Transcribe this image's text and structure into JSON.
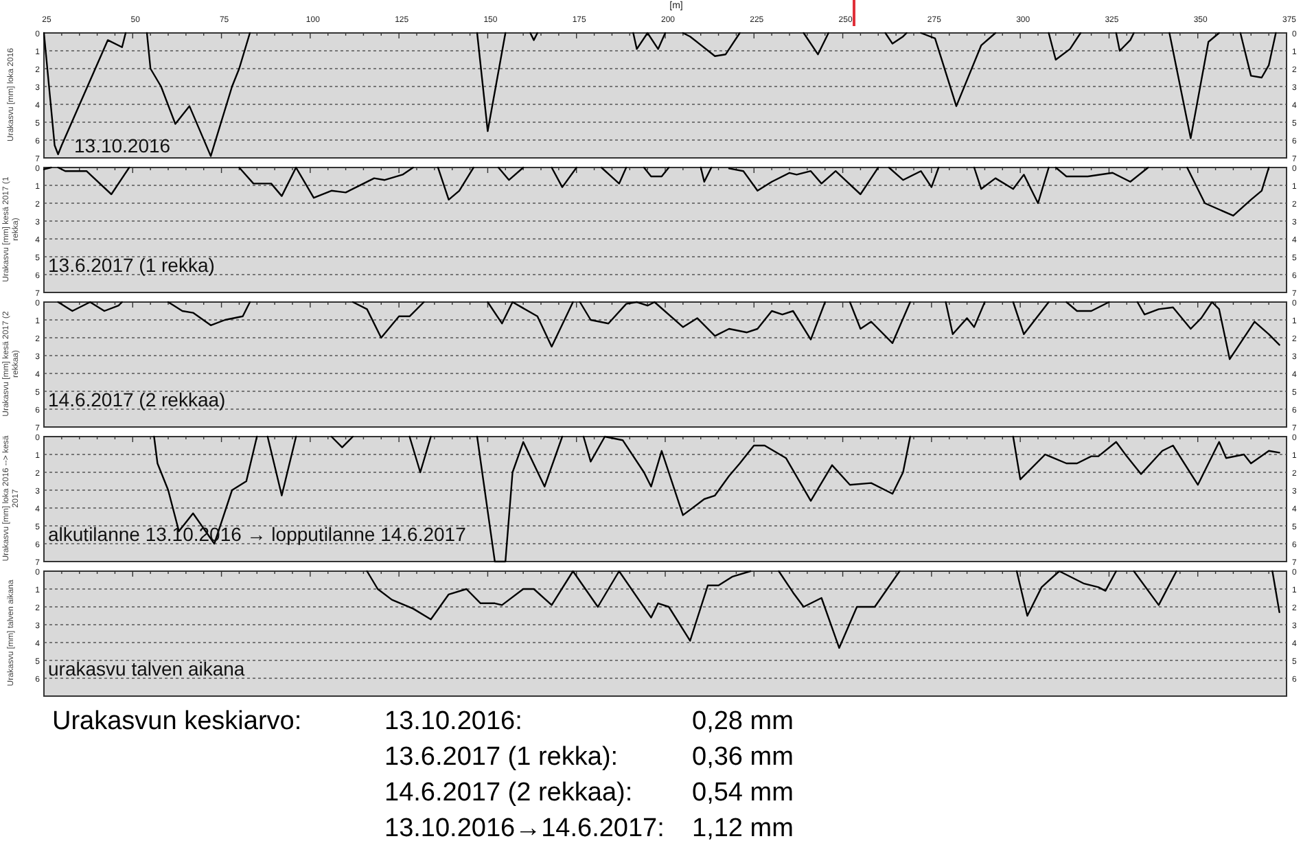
{
  "charts": [
    {
      "right_axis_labels": [
        "0",
        "1",
        "2",
        "3",
        "4",
        "5",
        "6",
        "7"
      ],
      "chart_data": {
        "type": "line",
        "title": "13.10.2016",
        "xlabel": "[m]",
        "ylabel": "Urakasvu [mm] loka 2016",
        "xlim": [
          25,
          375
        ],
        "ylim": [
          7,
          0
        ],
        "grid": true,
        "xticks": [
          25,
          50,
          75,
          100,
          125,
          150,
          175,
          200,
          225,
          250,
          275,
          300,
          325,
          350,
          375
        ],
        "yticks": [
          0,
          1,
          2,
          3,
          4,
          5,
          6,
          7
        ],
        "x": [
          25,
          28,
          29,
          30,
          43,
          47,
          48,
          51,
          54,
          55,
          58,
          62,
          66,
          72,
          78,
          80,
          83,
          115,
          147,
          150,
          155,
          158,
          162,
          163,
          164,
          178,
          191,
          192,
          195,
          198,
          200,
          202,
          205,
          207,
          214,
          217,
          221,
          230,
          239,
          243,
          246,
          254,
          262,
          264,
          267,
          268,
          270,
          272,
          276,
          282,
          289,
          293,
          300,
          308,
          310,
          314,
          317,
          322,
          327,
          328,
          331,
          332,
          337,
          342,
          348,
          353,
          356,
          359,
          362,
          365,
          368,
          370,
          372
        ],
        "series": [
          {
            "color": "#000000",
            "values": [
              0,
              6.3,
              6.8,
              6.3,
              0.4,
              0.8,
              0,
              null,
              0,
              2,
              3,
              5.1,
              4.1,
              6.9,
              3,
              2,
              0,
              null,
              0,
              5.5,
              0,
              null,
              0,
              0.4,
              0,
              null,
              0,
              0.9,
              0,
              0.9,
              0,
              null,
              0,
              0.2,
              1.3,
              1.2,
              0,
              null,
              0,
              1.2,
              0,
              null,
              0,
              0.6,
              0.2,
              0,
              null,
              0,
              0.3,
              4.1,
              0.7,
              0,
              null,
              0,
              1.5,
              0.9,
              0,
              null,
              0,
              1,
              0.4,
              0,
              null,
              0,
              5.9,
              0.5,
              0,
              null,
              0,
              2.4,
              2.5,
              1.8,
              0
            ]
          }
        ]
      }
    },
    {
      "right_axis_labels": [
        "0",
        "1",
        "2",
        "3",
        "4",
        "5",
        "6",
        "7"
      ],
      "chart_data": {
        "type": "line",
        "title": "13.6.2017 (1 rekka)",
        "ylabel": "Urakasvu [mm] kesä 2017 (1 rekka)",
        "xlim": [
          25,
          375
        ],
        "ylim": [
          7,
          0
        ],
        "grid": true,
        "yticks": [
          0,
          1,
          2,
          3,
          4,
          5,
          6,
          7
        ],
        "x": [
          25,
          27,
          28,
          29,
          31,
          37,
          44,
          49,
          64,
          80,
          84,
          89,
          92,
          96,
          101,
          106,
          110,
          118,
          121,
          126,
          129,
          132,
          136,
          139,
          142,
          146,
          150,
          153,
          156,
          160,
          164,
          168,
          171,
          175,
          178,
          182,
          187,
          189,
          191,
          194,
          196,
          199,
          201,
          206,
          210,
          211,
          213,
          216,
          218,
          222,
          226,
          230,
          235,
          237,
          241,
          244,
          248,
          255,
          260,
          262,
          263,
          267,
          272,
          275,
          277,
          282,
          287,
          289,
          293,
          298,
          301,
          305,
          308,
          309,
          310,
          313,
          319,
          326,
          331,
          336,
          341,
          347,
          352,
          360,
          365,
          368,
          370
        ],
        "series": [
          {
            "color": "#000000",
            "values": [
              0.1,
              0,
              null,
              0,
              0.2,
              0.2,
              1.5,
              0,
              null,
              0,
              0.9,
              0.9,
              1.6,
              0,
              1.7,
              1.3,
              1.4,
              0.6,
              0.7,
              0.4,
              0,
              null,
              0,
              1.8,
              1.3,
              0,
              null,
              0,
              0.7,
              0,
              null,
              0,
              1.1,
              0,
              null,
              0,
              0.9,
              0,
              null,
              0,
              0.5,
              0.5,
              0,
              null,
              0,
              0.8,
              0,
              null,
              0.05,
              0.2,
              1.3,
              0.8,
              0.3,
              0.4,
              0.2,
              0.9,
              0.2,
              1.5,
              0,
              null,
              0,
              0.7,
              0.2,
              1.1,
              0,
              null,
              0,
              1.2,
              0.6,
              1.2,
              0.4,
              2,
              0,
              null,
              0,
              0.5,
              0.5,
              0.3,
              0.8,
              0,
              null,
              0,
              2,
              2.7,
              1.8,
              1.3,
              0
            ]
          }
        ]
      }
    },
    {
      "right_axis_labels": [
        "0",
        "1",
        "2",
        "3",
        "4",
        "5",
        "6",
        "7"
      ],
      "chart_data": {
        "type": "line",
        "title": "14.6.2017 (2 rekkaa)",
        "ylabel": "Urakasvu [mm] kesä 2017 (2 rekkaa)",
        "xlim": [
          25,
          375
        ],
        "ylim": [
          7,
          0
        ],
        "grid": true,
        "yticks": [
          0,
          1,
          2,
          3,
          4,
          5,
          6,
          7
        ],
        "x": [
          29,
          33,
          38,
          42,
          46,
          47,
          54,
          60,
          64,
          67,
          72,
          76,
          81,
          83,
          98,
          112,
          116,
          120,
          125,
          128,
          132,
          141,
          150,
          154,
          157,
          164,
          168,
          174,
          175,
          176,
          179,
          184,
          189,
          192,
          195,
          197,
          205,
          209,
          214,
          218,
          223,
          226,
          230,
          233,
          236,
          241,
          245,
          248,
          252,
          255,
          258,
          264,
          269,
          274,
          279,
          281,
          285,
          287,
          290,
          294,
          298,
          301,
          308,
          310,
          313,
          316,
          320,
          325,
          329,
          333,
          335,
          339,
          343,
          348,
          351,
          354,
          356,
          359,
          366,
          370,
          373
        ],
        "series": [
          {
            "color": "#000000",
            "values": [
              0,
              0.5,
              0,
              0.5,
              0.2,
              0,
              null,
              0,
              0.5,
              0.6,
              1.3,
              1,
              0.8,
              0,
              null,
              0,
              0.4,
              2,
              0.8,
              0.8,
              0,
              null,
              0,
              1.2,
              0,
              0.8,
              2.5,
              0,
              null,
              0,
              1,
              1.2,
              0.1,
              0,
              0.2,
              0,
              1.4,
              0.9,
              1.9,
              1.5,
              1.7,
              1.5,
              0.5,
              0.7,
              0.5,
              2.1,
              0,
              null,
              0,
              1.5,
              1.1,
              2.3,
              0,
              null,
              0,
              1.8,
              0.9,
              1.4,
              0,
              null,
              0,
              1.8,
              0,
              null,
              0,
              0.5,
              0.5,
              0,
              null,
              0,
              0.7,
              0.4,
              0.3,
              1.5,
              0.9,
              0,
              0.4,
              3.2,
              1.1,
              1.8,
              2.4
            ]
          }
        ]
      }
    },
    {
      "right_axis_labels": [
        "0",
        "1",
        "2",
        "3",
        "4",
        "5",
        "6",
        "7"
      ],
      "chart_data": {
        "type": "line",
        "title": "alkutilanne 13.10.2016 → lopputilanne 14.6.2017",
        "ylabel": "Urakasvu [mm] loka 2016 --> kesä 2017",
        "xlim": [
          25,
          375
        ],
        "ylim": [
          7,
          0
        ],
        "grid": true,
        "yticks": [
          0,
          1,
          2,
          3,
          4,
          5,
          6,
          7
        ],
        "x": [
          56,
          57,
          60,
          63,
          67,
          73,
          78,
          82,
          85,
          87,
          88,
          92,
          96,
          101,
          106,
          109,
          112,
          120,
          128,
          131,
          134,
          140,
          147,
          152,
          155,
          157,
          160,
          166,
          171,
          174,
          177,
          179,
          183,
          188,
          194,
          196,
          199,
          205,
          211,
          214,
          218,
          221,
          225,
          228,
          234,
          241,
          247,
          252,
          258,
          262,
          264,
          267,
          269,
          284,
          298,
          300,
          307,
          313,
          316,
          320,
          322,
          327,
          330,
          334,
          340,
          343,
          350,
          356,
          358,
          363,
          365,
          370,
          373
        ],
        "series": [
          {
            "color": "#000000",
            "values": [
              0,
              1.5,
              3,
              5.3,
              4.3,
              6,
              3,
              2.5,
              0,
              null,
              0,
              3.3,
              0,
              null,
              0,
              0.6,
              0,
              null,
              0,
              2,
              0,
              null,
              0,
              7,
              7,
              2,
              0.3,
              2.8,
              0,
              null,
              0,
              1.4,
              0,
              0.2,
              2,
              2.8,
              0.8,
              4.4,
              3.5,
              3.3,
              2.2,
              1.5,
              0.5,
              0.5,
              1.2,
              3.6,
              1.6,
              2.7,
              2.6,
              3,
              3.2,
              2,
              0,
              null,
              0,
              2.4,
              1,
              1.5,
              1.5,
              1.1,
              1.1,
              0.3,
              1.1,
              2.1,
              0.8,
              0.5,
              2.7,
              0.3,
              1.2,
              1,
              1.5,
              0.8,
              0.9
            ]
          }
        ]
      }
    },
    {
      "right_axis_labels": [
        "0",
        "1",
        "2",
        "3",
        "4",
        "5",
        "6"
      ],
      "chart_data": {
        "type": "line",
        "title": "urakasvu talven  aikana",
        "ylabel": "Urakasvu [mm] talven aikana",
        "xlim": [
          25,
          375
        ],
        "ylim": [
          7,
          0
        ],
        "grid": true,
        "yticks": [
          0,
          1,
          2,
          3,
          4,
          5,
          6
        ],
        "x": [
          116,
          119,
          123,
          129,
          134,
          139,
          144,
          148,
          152,
          154,
          160,
          163,
          168,
          174,
          181,
          187,
          196,
          198,
          201,
          207,
          212,
          215,
          219,
          224,
          228,
          232,
          236,
          239,
          244,
          249,
          254,
          259,
          266,
          282,
          299,
          302,
          306,
          311,
          318,
          322,
          324,
          327,
          330,
          332,
          339,
          344,
          357,
          371,
          373
        ],
        "series": [
          {
            "color": "#000000",
            "values": [
              0,
              1,
              1.6,
              2.1,
              2.7,
              1.3,
              1,
              1.8,
              1.8,
              1.9,
              1,
              1,
              1.9,
              0,
              2,
              0,
              2.6,
              1.8,
              2,
              3.9,
              0.8,
              0.8,
              0.3,
              0,
              null,
              0,
              1.2,
              2,
              1.5,
              4.3,
              2,
              2,
              0,
              null,
              0,
              2.5,
              0.9,
              0,
              0.7,
              0.9,
              1.1,
              0,
              null,
              0,
              1.9,
              0,
              null,
              0,
              2.3
            ]
          }
        ]
      }
    }
  ],
  "summary": {
    "title": "Urakasvun keskiarvo:",
    "rows": [
      {
        "label": "13.10.2016:",
        "value": "0,28 mm"
      },
      {
        "label": "13.6.2017 (1 rekka):",
        "value": "0,36 mm"
      },
      {
        "label": "14.6.2017 (2 rekkaa):",
        "value": "0,54 mm"
      },
      {
        "label": "13.10.2016→14.6.2017:",
        "value": "1,12 mm"
      }
    ]
  }
}
